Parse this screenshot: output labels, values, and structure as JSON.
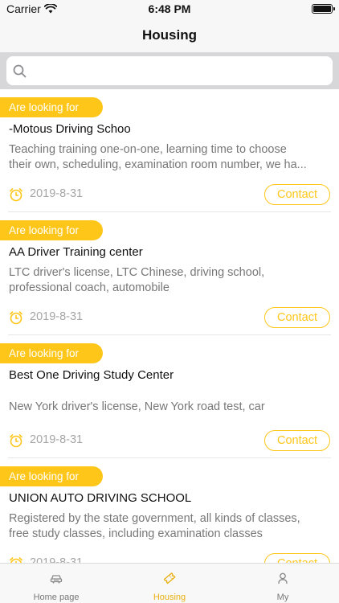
{
  "status_bar": {
    "carrier": "Carrier",
    "time": "6:48 PM"
  },
  "nav": {
    "title": "Housing"
  },
  "search": {
    "placeholder": "",
    "value": ""
  },
  "colors": {
    "accent": "#ffc61a",
    "active_tab": "#e8b010"
  },
  "listings": [
    {
      "tag": "Are looking for",
      "title": "-Motous Driving Schoo",
      "desc_lines": [
        "Teaching training one-on-one, learning time to choose",
        "their own, scheduling, examination room number, we ha..."
      ],
      "date": "2019-8-31",
      "contact": "Contact"
    },
    {
      "tag": "Are looking for",
      "title": "AA Driver Training center",
      "desc_lines": [
        "LTC driver's license, LTC Chinese, driving school,",
        "professional coach, automobile"
      ],
      "date": "2019-8-31",
      "contact": "Contact"
    },
    {
      "tag": "Are looking for",
      "title": "Best One Driving Study Center",
      "desc_lines": [
        "New York driver's license, New York road test, car"
      ],
      "date": "2019-8-31",
      "contact": "Contact"
    },
    {
      "tag": "Are looking for",
      "title": "UNION AUTO DRIVING SCHOOL",
      "desc_lines": [
        "Registered by the state government, all kinds of classes,",
        "free study classes, including examination classes"
      ],
      "date": "2019-8-31",
      "contact": "Contact"
    }
  ],
  "tabs": [
    {
      "label": "Home page",
      "icon": "car-icon"
    },
    {
      "label": "Housing",
      "icon": "ticket-icon",
      "active": true
    },
    {
      "label": "My",
      "icon": "person-icon"
    }
  ]
}
